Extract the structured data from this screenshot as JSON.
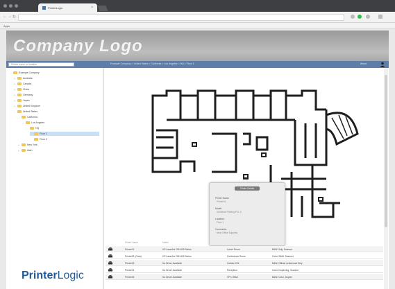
{
  "browser": {
    "tab_title": "PrinterLogic",
    "url": "",
    "bookmark": "Apps"
  },
  "header": {
    "logo_text": "Company Logo"
  },
  "search": {
    "placeholder": "Printer name or location"
  },
  "breadcrumb": [
    "Example Company",
    "United States",
    "California",
    "Los Angeles",
    "HQ",
    "Floor 1"
  ],
  "about_label": "About",
  "tree": [
    {
      "label": "Example Company",
      "level": 0,
      "toggle": "-"
    },
    {
      "label": "Australia",
      "level": 1,
      "toggle": "+"
    },
    {
      "label": "Canada",
      "level": 1,
      "toggle": "+"
    },
    {
      "label": "China",
      "level": 1,
      "toggle": "+"
    },
    {
      "label": "Germany",
      "level": 1,
      "toggle": "+"
    },
    {
      "label": "Japan",
      "level": 1,
      "toggle": "+"
    },
    {
      "label": "United Kingdom",
      "level": 1,
      "toggle": "+"
    },
    {
      "label": "United States",
      "level": 1,
      "toggle": "-"
    },
    {
      "label": "California",
      "level": 2,
      "toggle": "-"
    },
    {
      "label": "Los Angeles",
      "level": 3,
      "toggle": "-"
    },
    {
      "label": "HQ",
      "level": 4,
      "toggle": "-"
    },
    {
      "label": "Floor 1",
      "level": 5,
      "toggle": "",
      "selected": true
    },
    {
      "label": "Floor 2",
      "level": 5,
      "toggle": ""
    },
    {
      "label": "New York",
      "level": 2,
      "toggle": "+"
    },
    {
      "label": "Utah",
      "level": 2,
      "toggle": "+"
    }
  ],
  "brand": {
    "part1": "Printer",
    "part2": "Logic"
  },
  "popup": {
    "title": "Printer Details",
    "fields": [
      {
        "label": "Printer Name:",
        "value": "Printer01"
      },
      {
        "label": "Model:",
        "value": "Universal Printing PCL 6"
      },
      {
        "label": "Location:",
        "value": "Floor 1"
      },
      {
        "label": "Comments:",
        "value": "Near Office Supplies"
      }
    ]
  },
  "table": {
    "headers": [
      "Printer Name",
      "Model",
      "Location",
      "Comments"
    ],
    "rows": [
      [
        "Printer01",
        "HP LaserJet CM1415 Series",
        "Lunch Room",
        "B&W Only, Scanner"
      ],
      [
        "Printer02 (Color)",
        "HP LaserJet CM1415 Series",
        "Conference Room",
        "Color, B&W, Scanner"
      ],
      [
        "Printer03",
        "No Driver Available",
        "Cubicle 224",
        "B&W, Official Letterhead Only"
      ],
      [
        "Printer04",
        "No Driver Available",
        "Reception",
        "Color, Duplexing, Scanner"
      ],
      [
        "Printer05",
        "No Driver Available",
        "VP's Office",
        "B&W, Color, Duplex"
      ]
    ]
  }
}
